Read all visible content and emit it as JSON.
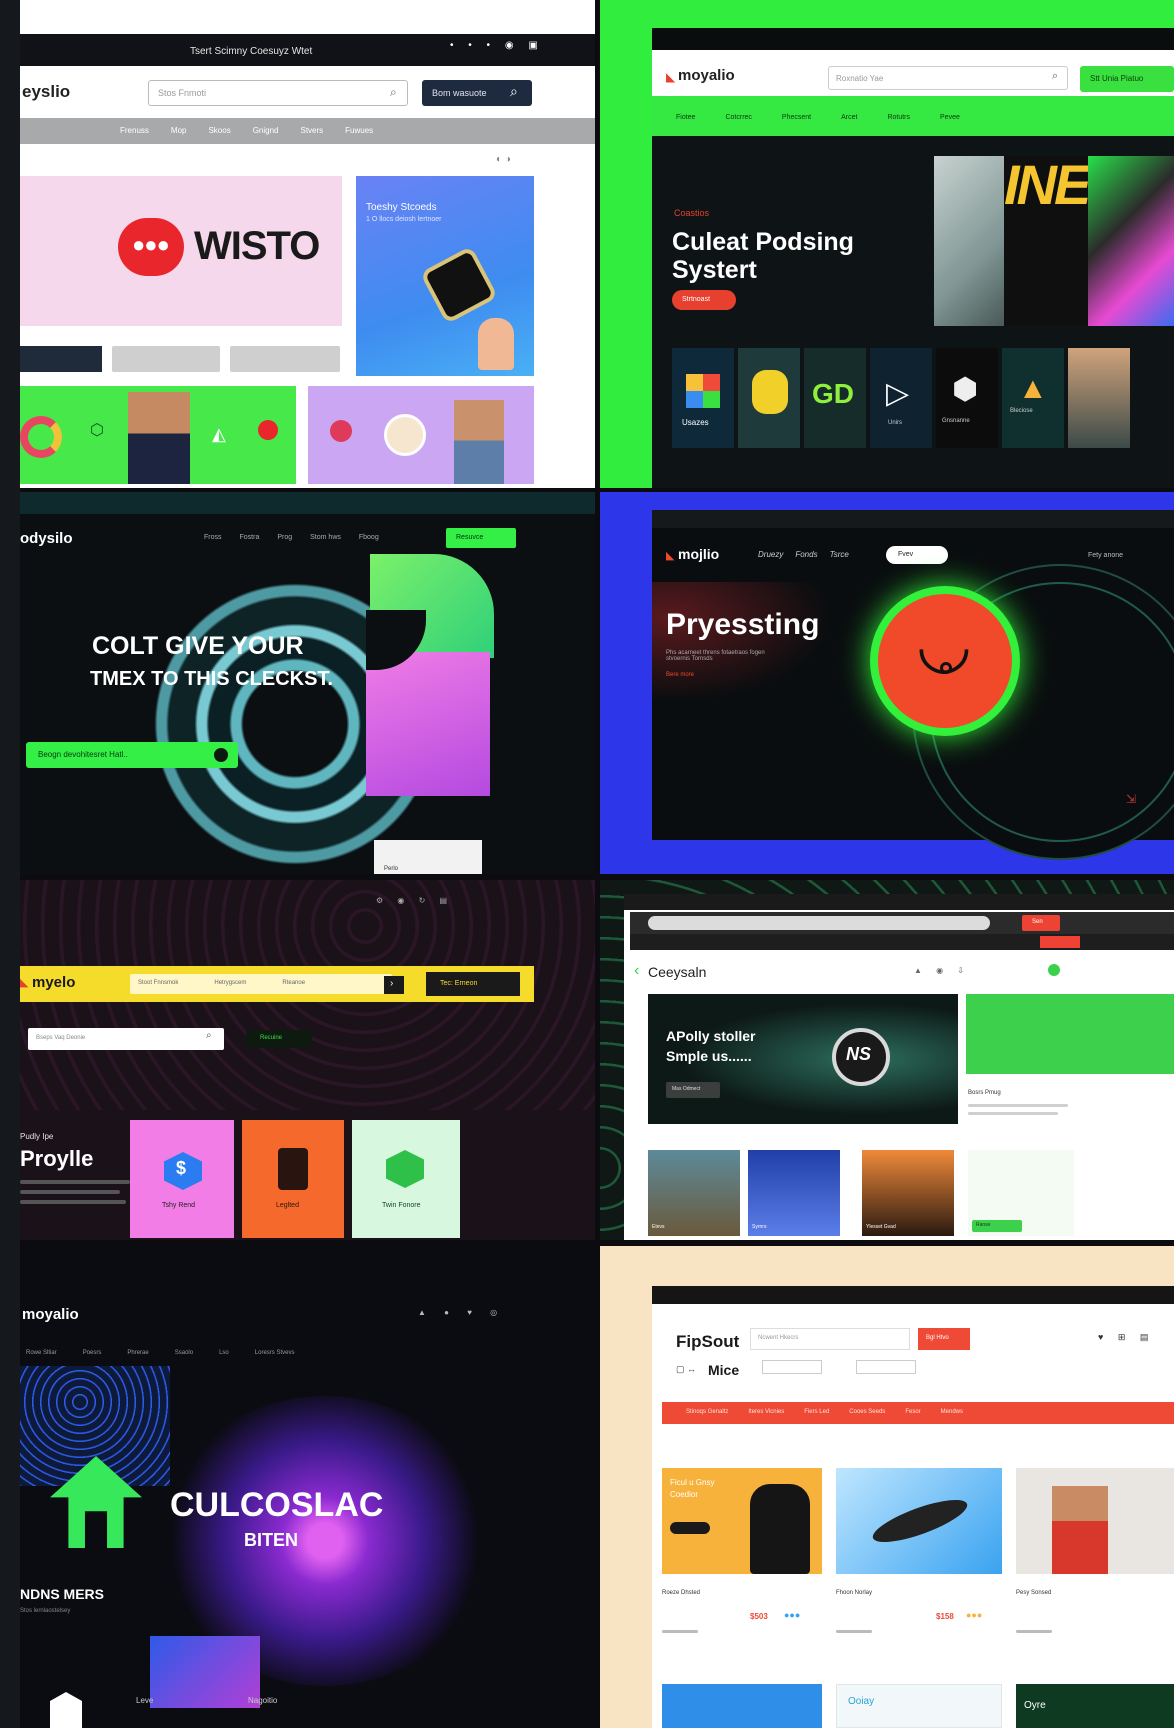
{
  "tiles": {
    "t1": {
      "topbar_title": "Tsert Scimny Coesuyz Wtet",
      "logo": "eyslio",
      "search_placeholder": "Stos Fnmoti",
      "search_button": "Bom wasuote",
      "nav": [
        "Frenuss",
        "Mop",
        "Skoos",
        "Gnignd",
        "Stvers",
        "Fuwues"
      ],
      "hero_brand": "WISTO",
      "side_card_title": "Toeshy Stcoeds",
      "side_card_sub": "1 O llocs deiosh lertnoer",
      "colors": {
        "bg": "#ffffff",
        "accent_red": "#e8262c",
        "bottom_green": "#47e84a",
        "side_blue": "#4e7bf0",
        "lilac": "#caa6f3"
      }
    },
    "t2": {
      "logo": "moyalio",
      "search_placeholder": "Roxnatio Yae",
      "cta": "Stt Unia Piatuo",
      "nav": [
        "Fiotee",
        "Cotcrrec",
        "Phecsent",
        "Arcet",
        "Rotutrs",
        "Pevee"
      ],
      "eyebrow": "Coastios",
      "headline_1": "Culeat Podsing",
      "headline_2": "Systert",
      "hero_button": "Strtnoast",
      "banner": "INE",
      "tiles_labels": [
        "Usazes",
        "GD",
        "Unirs",
        "Gnsnanne",
        "Bleciose"
      ],
      "colors": {
        "frame": "#31ee3e",
        "bg": "#0e1416",
        "cta": "#3ae040",
        "hero_button": "#e8402f"
      }
    },
    "t3": {
      "logo": "odysilo",
      "nav": [
        "Fross",
        "Fostra",
        "Prog",
        "Stom hws",
        "Fboog"
      ],
      "nav_button": "Resuvce",
      "headline_1": "COLT GIVE YOUR",
      "headline_2": "TMEX TO THIS CLECKST.",
      "cta": "Beogn devohitesret Hatl..",
      "footer_tag": "Perlo",
      "colors": {
        "bg": "#0b0f12",
        "cta": "#34f046",
        "swirl": "#5fb6bf",
        "shape_green": "#47ef66",
        "shape_pink": "#e05ce6"
      }
    },
    "t4": {
      "logo": "mojlio",
      "nav": [
        "Druezy",
        "Fonds",
        "Tsrce"
      ],
      "toggle_label": "Fvev",
      "nav_right": "Fety anone",
      "headline": "Pryessting",
      "subline": "Phs acarneet threns fotaetraos fogen stvoernis Tornsds",
      "link": "Bere more",
      "colors": {
        "frame": "#2d36e8",
        "bg": "#0a0d0f",
        "ring": "#33f03a",
        "disc": "#f04a2a"
      }
    },
    "t5": {
      "logo": "myelo",
      "search_fields": [
        "Stoot Fnnsmok",
        "Hetrygscem",
        "Rteanoe"
      ],
      "search_button": "Tec: Erneon",
      "second_search": "Bseps Vaq Deonie",
      "chip": "Recuine",
      "title_small": "Pudly Ipe",
      "title": "Proylle",
      "cards": [
        "Tshy Rend",
        "Leglted",
        "Twin Fonore"
      ],
      "colors": {
        "bg": "#1b1118",
        "yellow": "#f6dc2a",
        "pink": "#f27de6",
        "orange": "#f56a2c",
        "mint": "#d8f7df"
      }
    },
    "t6": {
      "logo": "Ceeysaln",
      "search_button": "Sen",
      "headline_1": "APolly stoller",
      "headline_2": "Smple us......",
      "hero_button": "Mas Odmect",
      "badge": "NS",
      "thumbs": [
        "Etevs",
        "Syrnrs",
        "Ylesset Gvad",
        "Ranse"
      ],
      "side_title": "Bosrs Pmug",
      "colors": {
        "frame": "#0f1814",
        "accent_green": "#3cd04d",
        "accent_red": "#ee4234",
        "page": "#ffffff"
      }
    },
    "t7": {
      "logo": "moyalio",
      "nav": [
        "Rowe Sltiar",
        "Poesrs",
        "Phrerae",
        "Ssaolo",
        "Lso",
        "Loresrs Stvevs"
      ],
      "headline": "CULCOSLAC",
      "subline": "BITEN",
      "left_caption": "NDNS MERS",
      "left_sub": "Stos lernlaostelsey",
      "footer_cols": [
        "Leve",
        "Nagoitio"
      ],
      "colors": {
        "bg": "#0b0b12",
        "arrow": "#36e85a",
        "burst": "#b23fd6",
        "blue": "#2e5ae8"
      }
    },
    "t8": {
      "logo": "FipSout",
      "search_placeholder": "Ncwent Hkecrs",
      "search_button": "Bgl Htvo",
      "sub_logo": "Mice",
      "menu": [
        "Stinoqs Genaltz",
        "Iteres Vicnies",
        "Fiers Led",
        "Cooes Seeds",
        "Fesor",
        "Mendws"
      ],
      "cards": [
        {
          "name": "Roeze Dhsted",
          "price": "$503"
        },
        {
          "name": "Fhoon Norlay",
          "price": "$158"
        },
        {
          "name": "Pesy Sonsed",
          "price": ""
        }
      ],
      "promo_title": "Ficul u Gnsy",
      "promo_sub": "Coedior",
      "bottom_tag": "Ooiay",
      "bottom_tag2": "Oyre",
      "colors": {
        "frame": "#f8e3c2",
        "page": "#ffffff",
        "red": "#ef4a36",
        "yellow": "#f7b23b",
        "blue": "#3aa3f0"
      }
    }
  }
}
